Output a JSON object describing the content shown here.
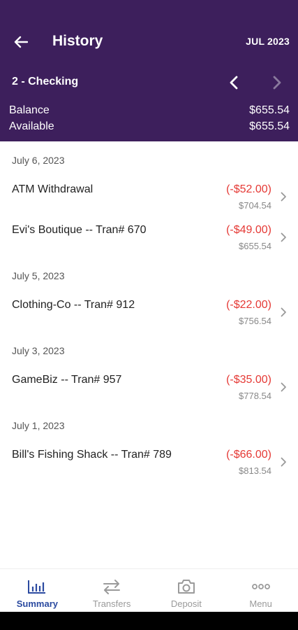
{
  "header": {
    "title": "History",
    "month": "JUL 2023",
    "account": "2 - Checking",
    "balance_label": "Balance",
    "balance_value": "$655.54",
    "available_label": "Available",
    "available_value": "$655.54"
  },
  "groups": [
    {
      "date": "July 6, 2023",
      "transactions": [
        {
          "description": "ATM Withdrawal",
          "amount": "(-$52.00)",
          "balance": "$704.54"
        },
        {
          "description": "Evi's Boutique -- Tran# 670",
          "amount": "(-$49.00)",
          "balance": "$655.54"
        }
      ]
    },
    {
      "date": "July 5, 2023",
      "transactions": [
        {
          "description": "Clothing-Co -- Tran# 912",
          "amount": "(-$22.00)",
          "balance": "$756.54"
        }
      ]
    },
    {
      "date": "July 3, 2023",
      "transactions": [
        {
          "description": "GameBiz -- Tran# 957",
          "amount": "(-$35.00)",
          "balance": "$778.54"
        }
      ]
    },
    {
      "date": "July 1, 2023",
      "transactions": [
        {
          "description": "Bill's Fishing Shack -- Tran# 789",
          "amount": "(-$66.00)",
          "balance": "$813.54"
        }
      ]
    }
  ],
  "tabs": [
    {
      "label": "Summary",
      "icon": "bar-chart-icon",
      "active": true
    },
    {
      "label": "Transfers",
      "icon": "transfer-arrows-icon",
      "active": false
    },
    {
      "label": "Deposit",
      "icon": "camera-icon",
      "active": false
    },
    {
      "label": "Menu",
      "icon": "more-dots-icon",
      "active": false
    }
  ],
  "colors": {
    "header_bg": "#3d1f5c",
    "debit": "#e53935",
    "active_tab": "#2b4aa0"
  }
}
